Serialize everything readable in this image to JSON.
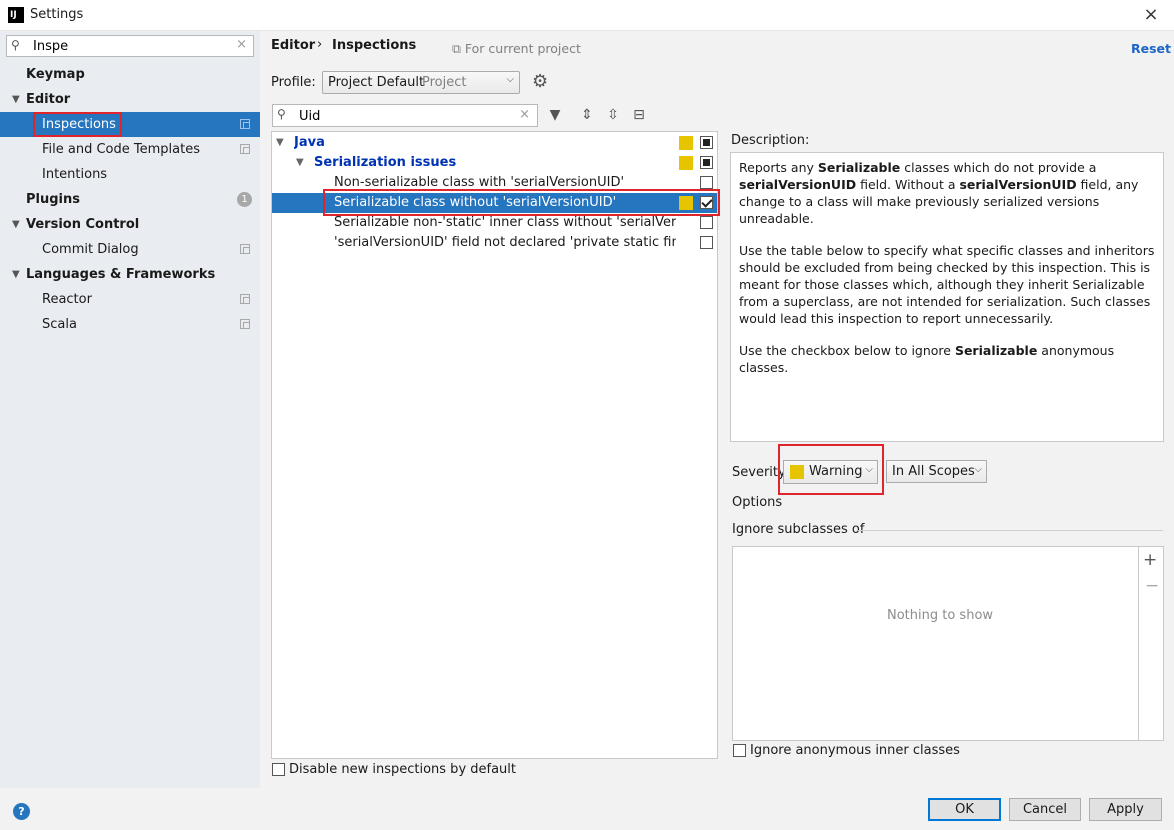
{
  "window": {
    "title": "Settings",
    "close_icon": "×"
  },
  "sidebar": {
    "search_value": "Inspe",
    "items": [
      {
        "label": "Keymap"
      },
      {
        "label": "Editor"
      },
      {
        "label": "Inspections"
      },
      {
        "label": "File and Code Templates"
      },
      {
        "label": "Intentions"
      },
      {
        "label": "Plugins",
        "badge": "1"
      },
      {
        "label": "Version Control"
      },
      {
        "label": "Commit Dialog"
      },
      {
        "label": "Languages & Frameworks"
      },
      {
        "label": "Reactor"
      },
      {
        "label": "Scala"
      }
    ]
  },
  "header": {
    "breadcrumb": [
      "Editor",
      "Inspections"
    ],
    "separator": "›",
    "for_current_project": "For current project",
    "reset": "Reset"
  },
  "profile": {
    "label": "Profile:",
    "value": "Project Default",
    "scope": "Project"
  },
  "inspection_search": {
    "value": "Uid"
  },
  "tree": {
    "rows": [
      {
        "label": "Java"
      },
      {
        "label": "Serialization issues"
      },
      {
        "label": "Non-serializable class with 'serialVersionUID'"
      },
      {
        "label": "Serializable class without 'serialVersionUID'"
      },
      {
        "label": "Serializable non-'static' inner class without 'serialVersionUI"
      },
      {
        "label": "'serialVersionUID' field not declared 'private static final lon"
      }
    ]
  },
  "disable_new": "Disable new inspections by default",
  "description": {
    "label": "Description:",
    "p1_a": "Reports any ",
    "p1_b": "Serializable",
    "p1_c": " classes which do not provide a ",
    "p1_d": "serialVersionUID",
    "p1_e": " field. Without a ",
    "p1_f": "serialVersionUID",
    "p1_g": " field, any change to a class will make previously serialized versions unreadable.",
    "p2": "Use the table below to specify what specific classes and inheritors should be excluded from being checked by this inspection. This is meant for those classes which, although they inherit Serializable from a superclass, are not intended for serialization. Such classes would lead this inspection to report unnecessarily.",
    "p3_a": "Use the checkbox below to ignore ",
    "p3_b": "Serializable",
    "p3_c": " anonymous classes."
  },
  "severity": {
    "label": "Severity",
    "value": "Warning",
    "scope": "In All Scopes",
    "color": "#e6c500"
  },
  "options": {
    "label": "Options",
    "ignore_label": "Ignore subclasses of",
    "nothing": "Nothing to show",
    "anon": "Ignore anonymous inner classes"
  },
  "footer": {
    "ok": "OK",
    "cancel": "Cancel",
    "apply": "Apply",
    "help": "?"
  },
  "colors": {
    "selection": "#2675bf",
    "highlight_box": "#e0242c",
    "category_text": "#0033b3"
  }
}
